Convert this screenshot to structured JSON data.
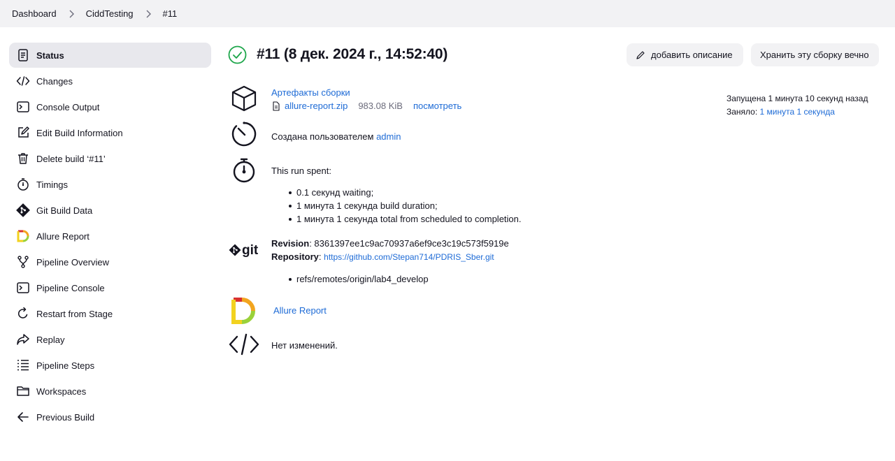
{
  "breadcrumbs": [
    "Dashboard",
    "CiddTesting",
    "#11"
  ],
  "sidebar": {
    "items": [
      {
        "label": "Status",
        "icon": "status-icon"
      },
      {
        "label": "Changes",
        "icon": "code-icon"
      },
      {
        "label": "Console Output",
        "icon": "terminal-icon"
      },
      {
        "label": "Edit Build Information",
        "icon": "edit-icon"
      },
      {
        "label": "Delete build ‘#11’",
        "icon": "trash-icon"
      },
      {
        "label": "Timings",
        "icon": "stopwatch-icon"
      },
      {
        "label": "Git Build Data",
        "icon": "git-icon"
      },
      {
        "label": "Allure Report",
        "icon": "allure-icon"
      },
      {
        "label": "Pipeline Overview",
        "icon": "pipeline-overview-icon"
      },
      {
        "label": "Pipeline Console",
        "icon": "terminal-icon"
      },
      {
        "label": "Restart from Stage",
        "icon": "restart-icon"
      },
      {
        "label": "Replay",
        "icon": "replay-icon"
      },
      {
        "label": "Pipeline Steps",
        "icon": "steps-icon"
      },
      {
        "label": "Workspaces",
        "icon": "folder-icon"
      },
      {
        "label": "Previous Build",
        "icon": "arrow-left-icon"
      }
    ]
  },
  "build": {
    "title": "#11 (8 дек. 2024 г., 14:52:40)",
    "status_color": "#1ea64b",
    "add_description": "добавить описание",
    "keep_forever": "Хранить эту сборку вечно",
    "started": "Запущена 1 минута 10 секунд назад",
    "took_label": "Заняло:",
    "took_value": "1 минута 1 секунда"
  },
  "artifacts": {
    "heading": "Артефакты сборки",
    "file": "allure-report.zip",
    "size": "983.08 KiB",
    "view": "посмотреть"
  },
  "cause": {
    "text": "Создана пользователем",
    "user": "admin"
  },
  "timing": {
    "heading": "This run spent:",
    "items": [
      "0.1 секунд waiting;",
      "1 минута 1 секунда build duration;",
      "1 минута 1 секунда total from scheduled to completion."
    ]
  },
  "git": {
    "logo": "git",
    "revision_label": "Revision",
    "revision": "8361397ee1c9ac70937a6ef9ce3c19c573f5919e",
    "repository_label": "Repository",
    "repository": "https://github.com/Stepan714/PDRIS_Sber.git",
    "refs": [
      "refs/remotes/origin/lab4_develop"
    ]
  },
  "allure": {
    "link": "Allure Report"
  },
  "changes": {
    "text": "Нет изменений."
  },
  "colors": {
    "link": "#1e6bd6",
    "active_bg": "#e8e8ed",
    "topbar_bg": "#f2f2f4"
  }
}
